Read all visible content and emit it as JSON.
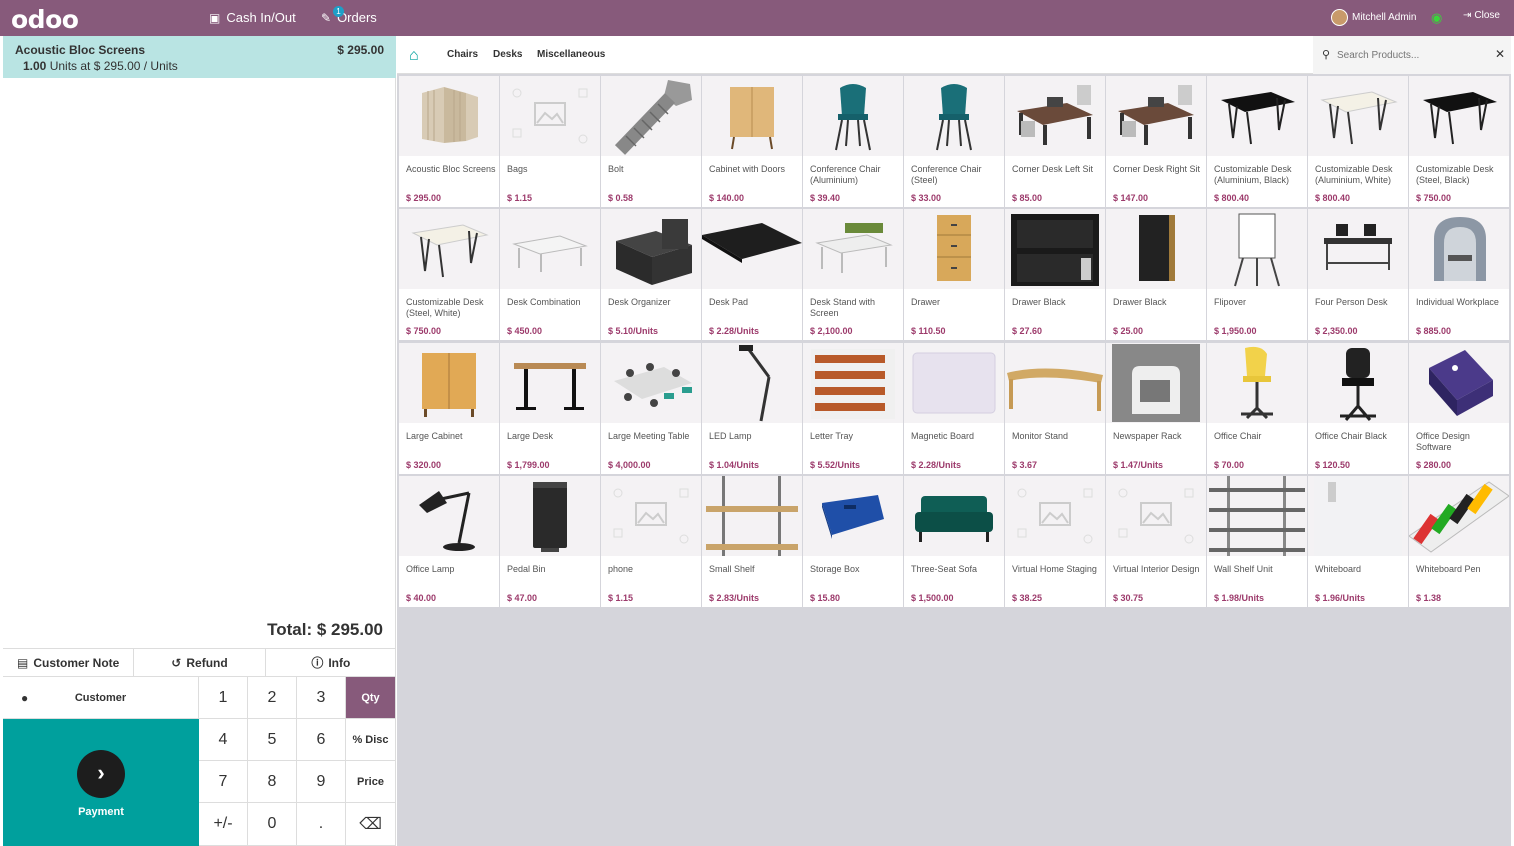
{
  "topbar": {
    "logo": "odoo",
    "cash_label": "Cash In/Out",
    "orders_label": "Orders",
    "orders_count": "1",
    "user_name": "Mitchell Admin",
    "close_label": "Close"
  },
  "order": {
    "line": {
      "name": "Acoustic Bloc Screens",
      "price": "$ 295.00",
      "qty": "1.00",
      "detail": "Units at $ 295.00 / Units"
    },
    "total": "Total: $ 295.00"
  },
  "actions": {
    "customer_note": "Customer Note",
    "refund": "Refund",
    "info": "Info"
  },
  "numpad": {
    "customer": "Customer",
    "payment": "Payment",
    "keys": [
      "1",
      "2",
      "3",
      "4",
      "5",
      "6",
      "7",
      "8",
      "9",
      "+/-",
      "0",
      "."
    ],
    "modes": [
      "Qty",
      "% Disc",
      "Price"
    ]
  },
  "categories": {
    "items": [
      "Chairs",
      "Desks",
      "Miscellaneous"
    ],
    "search_placeholder": "Search Products..."
  },
  "products": [
    {
      "name": "Acoustic Bloc Screens",
      "price": "$ 295.00",
      "img": "screen"
    },
    {
      "name": "Bags",
      "price": "$ 1.15",
      "img": "placeholder"
    },
    {
      "name": "Bolt",
      "price": "$ 0.58",
      "img": "bolt"
    },
    {
      "name": "Cabinet with Doors",
      "price": "$ 140.00",
      "img": "cabinet"
    },
    {
      "name": "Conference Chair (Aluminium)",
      "price": "$ 39.40",
      "img": "chair-teal"
    },
    {
      "name": "Conference Chair (Steel)",
      "price": "$ 33.00",
      "img": "chair-teal"
    },
    {
      "name": "Corner Desk Left Sit",
      "price": "$ 85.00",
      "img": "corner-desk"
    },
    {
      "name": "Corner Desk Right Sit",
      "price": "$ 147.00",
      "img": "corner-desk"
    },
    {
      "name": "Customizable Desk (Aluminium, Black)",
      "price": "$ 800.40",
      "img": "desk-black"
    },
    {
      "name": "Customizable Desk (Aluminium, White)",
      "price": "$ 800.40",
      "img": "desk-white"
    },
    {
      "name": "Customizable Desk (Steel, Black)",
      "price": "$ 750.00",
      "img": "desk-black"
    },
    {
      "name": "Customizable Desk (Steel, White)",
      "price": "$ 750.00",
      "img": "desk-white"
    },
    {
      "name": "Desk Combination",
      "price": "$ 450.00",
      "img": "desk-combo"
    },
    {
      "name": "Desk Organizer",
      "price": "$ 5.10/Units",
      "img": "organizer"
    },
    {
      "name": "Desk Pad",
      "price": "$ 2.28/Units",
      "img": "deskpad"
    },
    {
      "name": "Desk Stand with Screen",
      "price": "$ 2,100.00",
      "img": "desk-stand"
    },
    {
      "name": "Drawer",
      "price": "$ 110.50",
      "img": "drawer"
    },
    {
      "name": "Drawer Black",
      "price": "$ 27.60",
      "img": "drawer-black"
    },
    {
      "name": "Drawer Black",
      "price": "$ 25.00",
      "img": "drawer-black2"
    },
    {
      "name": "Flipover",
      "price": "$ 1,950.00",
      "img": "flipover"
    },
    {
      "name": "Four Person Desk",
      "price": "$ 2,350.00",
      "img": "four-desk"
    },
    {
      "name": "Individual Workplace",
      "price": "$ 885.00",
      "img": "workplace"
    },
    {
      "name": "Large Cabinet",
      "price": "$ 320.00",
      "img": "large-cabinet"
    },
    {
      "name": "Large Desk",
      "price": "$ 1,799.00",
      "img": "large-desk"
    },
    {
      "name": "Large Meeting Table",
      "price": "$ 4,000.00",
      "img": "meeting-table"
    },
    {
      "name": "LED Lamp",
      "price": "$ 1.04/Units",
      "img": "led-lamp"
    },
    {
      "name": "Letter Tray",
      "price": "$ 5.52/Units",
      "img": "letter-tray"
    },
    {
      "name": "Magnetic Board",
      "price": "$ 2.28/Units",
      "img": "magnetic-board"
    },
    {
      "name": "Monitor Stand",
      "price": "$ 3.67",
      "img": "monitor-stand"
    },
    {
      "name": "Newspaper Rack",
      "price": "$ 1.47/Units",
      "img": "newspaper-rack"
    },
    {
      "name": "Office Chair",
      "price": "$ 70.00",
      "img": "office-chair"
    },
    {
      "name": "Office Chair Black",
      "price": "$ 120.50",
      "img": "office-chair-black"
    },
    {
      "name": "Office Design Software",
      "price": "$ 280.00",
      "img": "software"
    },
    {
      "name": "Office Lamp",
      "price": "$ 40.00",
      "img": "office-lamp"
    },
    {
      "name": "Pedal Bin",
      "price": "$ 47.00",
      "img": "pedal-bin"
    },
    {
      "name": "phone",
      "price": "$ 1.15",
      "img": "placeholder"
    },
    {
      "name": "Small Shelf",
      "price": "$ 2.83/Units",
      "img": "small-shelf"
    },
    {
      "name": "Storage Box",
      "price": "$ 15.80",
      "img": "storage-box"
    },
    {
      "name": "Three-Seat Sofa",
      "price": "$ 1,500.00",
      "img": "sofa"
    },
    {
      "name": "Virtual Home Staging",
      "price": "$ 38.25",
      "img": "placeholder"
    },
    {
      "name": "Virtual Interior Design",
      "price": "$ 30.75",
      "img": "placeholder"
    },
    {
      "name": "Wall Shelf Unit",
      "price": "$ 1.98/Units",
      "img": "wall-shelf"
    },
    {
      "name": "Whiteboard",
      "price": "$ 1.96/Units",
      "img": "whiteboard"
    },
    {
      "name": "Whiteboard Pen",
      "price": "$ 1.38",
      "img": "pens"
    }
  ],
  "colors": {
    "brand": "#875a7b",
    "accent": "#00a09d",
    "price": "#9c3a6b",
    "orderline_selected": "#b9e4e3"
  }
}
